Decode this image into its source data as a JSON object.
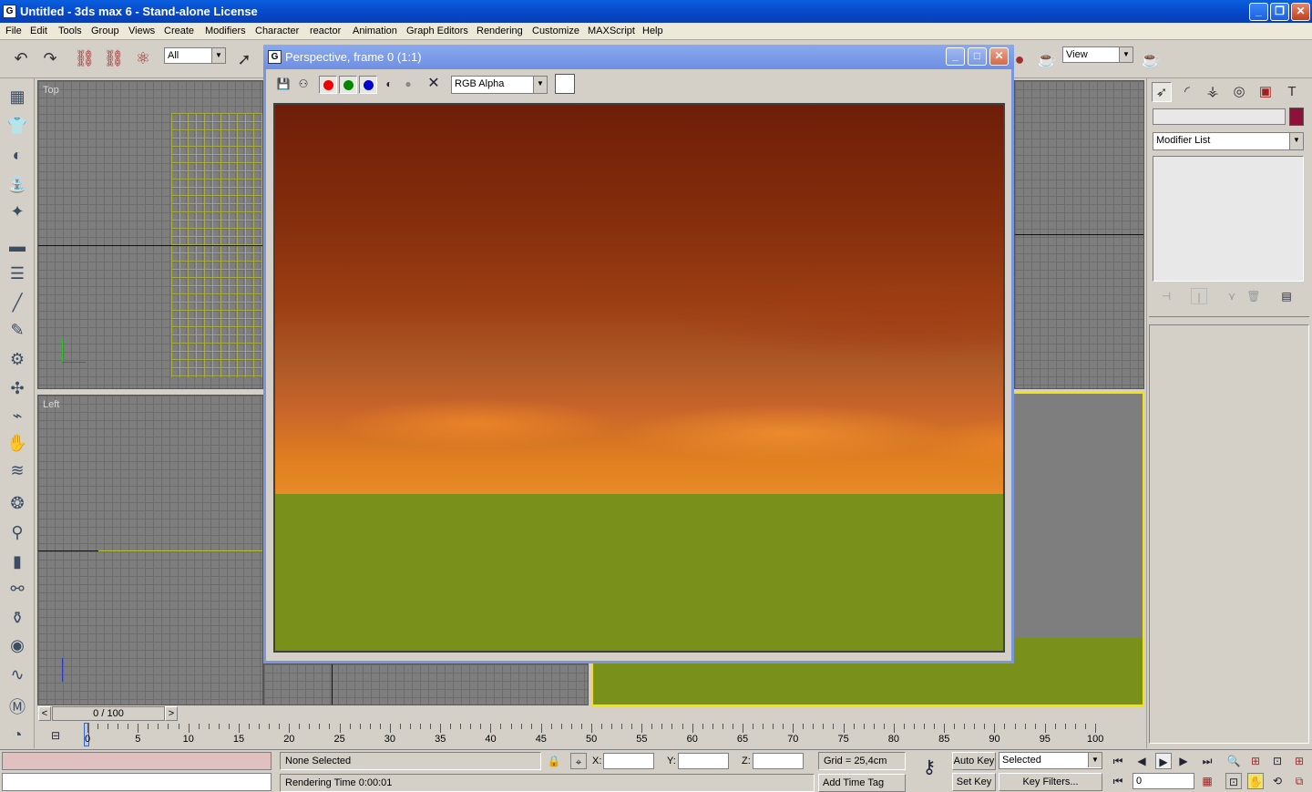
{
  "window": {
    "title": "Untitled - 3ds max 6 - Stand-alone License"
  },
  "menu": [
    "File",
    "Edit",
    "Tools",
    "Group",
    "Views",
    "Create",
    "Modifiers",
    "Character",
    "reactor",
    "Animation",
    "Graph Editors",
    "Rendering",
    "Customize",
    "MAXScript",
    "Help"
  ],
  "toolbar": {
    "selection_filter": "All",
    "ref_coord": "View"
  },
  "viewports": {
    "top_label": "Top",
    "left_label": "Left"
  },
  "render_window": {
    "title": "Perspective, frame 0 (1:1)",
    "channel": "RGB Alpha"
  },
  "command_panel": {
    "modifier_list": "Modifier List",
    "object_color": "#8c1237"
  },
  "time_slider": {
    "position": "0 / 100",
    "prev": "<",
    "next": ">"
  },
  "trackbar": {
    "ticks": [
      "0",
      "5",
      "10",
      "15",
      "20",
      "25",
      "30",
      "35",
      "40",
      "45",
      "50",
      "55",
      "60",
      "65",
      "70",
      "75",
      "80",
      "85",
      "90",
      "95",
      "100"
    ]
  },
  "status": {
    "selection": "None Selected",
    "rendering_time": "Rendering Time  0:00:01",
    "x_label": "X:",
    "y_label": "Y:",
    "z_label": "Z:",
    "grid": "Grid = 25,4cm",
    "add_time_tag": "Add Time Tag",
    "auto_key": "Auto Key",
    "set_key": "Set Key",
    "key_mode": "Selected",
    "key_filters": "Key Filters...",
    "current_frame": "0"
  }
}
